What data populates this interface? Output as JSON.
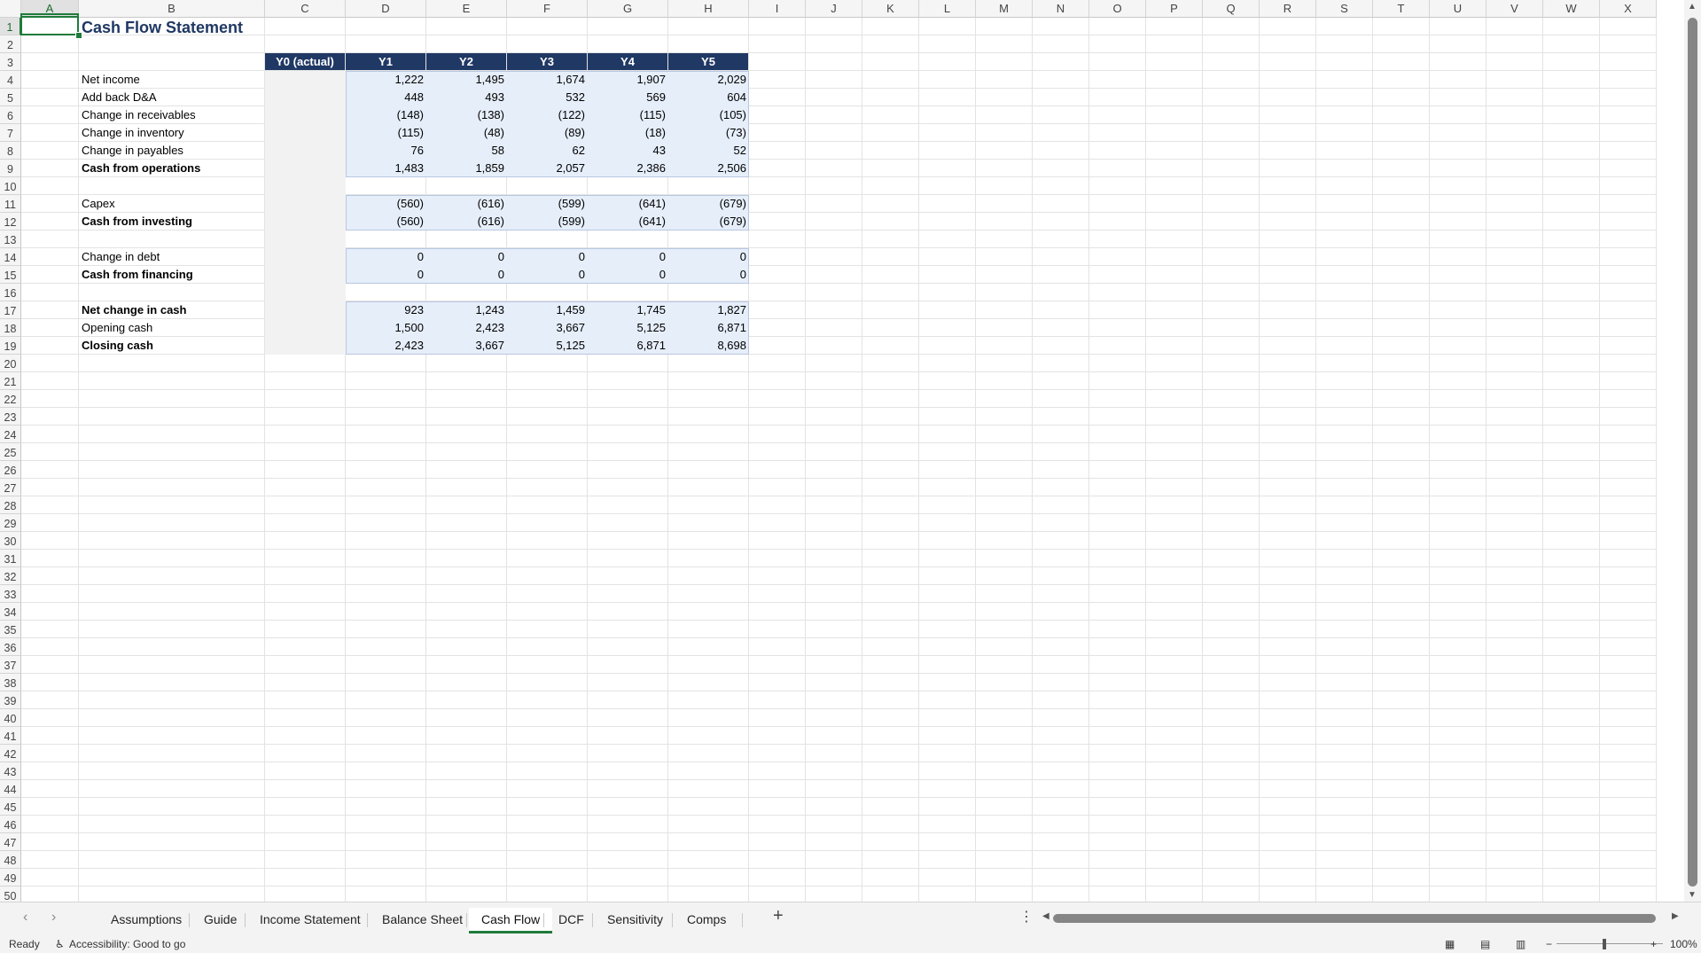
{
  "columns": [
    "A",
    "B",
    "C",
    "D",
    "E",
    "F",
    "G",
    "H",
    "I",
    "J",
    "K",
    "L",
    "M",
    "N",
    "O",
    "P",
    "Q",
    "R",
    "S",
    "T",
    "U",
    "V",
    "W",
    "X"
  ],
  "selected_column": "A",
  "selected_row": 1,
  "title": "Cash Flow Statement",
  "header_row": [
    "Y0 (actual)",
    "Y1",
    "Y2",
    "Y3",
    "Y4",
    "Y5"
  ],
  "rows": [
    {
      "row": 4,
      "label": "Net income",
      "bold": false,
      "values": [
        "1,222",
        "1,495",
        "1,674",
        "1,907",
        "2,029"
      ]
    },
    {
      "row": 5,
      "label": "Add back D&A",
      "bold": false,
      "values": [
        "448",
        "493",
        "532",
        "569",
        "604"
      ]
    },
    {
      "row": 6,
      "label": "Change in receivables",
      "bold": false,
      "values": [
        "(148)",
        "(138)",
        "(122)",
        "(115)",
        "(105)"
      ]
    },
    {
      "row": 7,
      "label": "Change in inventory",
      "bold": false,
      "values": [
        "(115)",
        "(48)",
        "(89)",
        "(18)",
        "(73)"
      ]
    },
    {
      "row": 8,
      "label": "Change in payables",
      "bold": false,
      "values": [
        "76",
        "58",
        "62",
        "43",
        "52"
      ]
    },
    {
      "row": 9,
      "label": "Cash from operations",
      "bold": true,
      "values": [
        "1,483",
        "1,859",
        "2,057",
        "2,386",
        "2,506"
      ]
    },
    {
      "row": 11,
      "label": "Capex",
      "bold": false,
      "values": [
        "(560)",
        "(616)",
        "(599)",
        "(641)",
        "(679)"
      ]
    },
    {
      "row": 12,
      "label": "Cash from investing",
      "bold": true,
      "values": [
        "(560)",
        "(616)",
        "(599)",
        "(641)",
        "(679)"
      ]
    },
    {
      "row": 14,
      "label": "Change in debt",
      "bold": false,
      "values": [
        "0",
        "0",
        "0",
        "0",
        "0"
      ]
    },
    {
      "row": 15,
      "label": "Cash from financing",
      "bold": true,
      "values": [
        "0",
        "0",
        "0",
        "0",
        "0"
      ]
    },
    {
      "row": 17,
      "label": "Net change in cash",
      "bold": true,
      "values": [
        "923",
        "1,243",
        "1,459",
        "1,745",
        "1,827"
      ]
    },
    {
      "row": 18,
      "label": "Opening cash",
      "bold": false,
      "values": [
        "1,500",
        "2,423",
        "3,667",
        "5,125",
        "6,871"
      ]
    },
    {
      "row": 19,
      "label": "Closing cash",
      "bold": true,
      "values": [
        "2,423",
        "3,667",
        "5,125",
        "6,871",
        "8,698"
      ]
    }
  ],
  "sheet_tabs": [
    "Assumptions",
    "Guide",
    "Income Statement",
    "Balance Sheet",
    "Cash Flow",
    "DCF",
    "Sensitivity",
    "Comps"
  ],
  "active_tab": "Cash Flow",
  "status": {
    "ready": "Ready",
    "accessibility": "Accessibility: Good to go",
    "zoom": "100%"
  },
  "icons": {
    "prev_sheet": "chevron-left-icon",
    "next_sheet": "chevron-right-icon",
    "add_sheet": "plus-icon",
    "more": "vertical-dots-icon",
    "normal_view": "grid-view-icon",
    "page_layout": "page-layout-icon",
    "page_break": "page-break-icon"
  },
  "colors": {
    "header_fill": "#1f3864",
    "input_fill": "#e6eefa",
    "y0_fill": "#f2f2f2",
    "selection": "#1e7b3a"
  }
}
